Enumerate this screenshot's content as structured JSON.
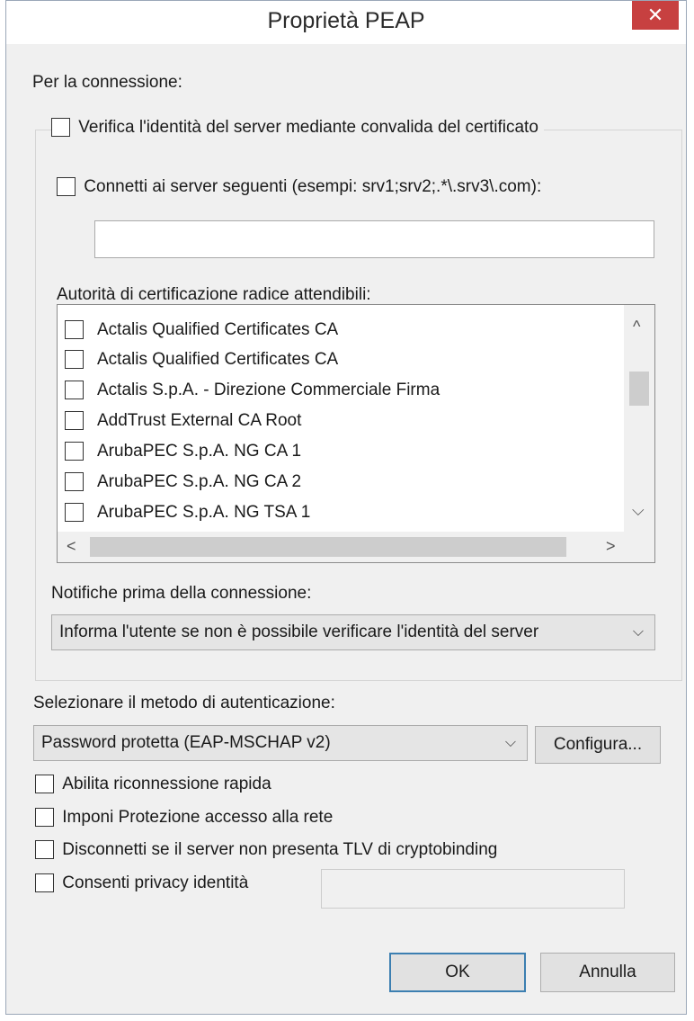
{
  "window": {
    "title": "Proprietà PEAP",
    "close_glyph": "✕"
  },
  "connection": {
    "label": "Per la connessione:",
    "verify_server": {
      "label": "Verifica l'identità del server mediante convalida del certificato",
      "checked": false
    },
    "connect_servers": {
      "label": "Connetti ai server seguenti (esempi: srv1;srv2;.*\\.srv3\\.com):",
      "checked": false,
      "value": ""
    },
    "trusted_ca_label": "Autorità di certificazione radice attendibili:",
    "trusted_ca": [
      {
        "name": "Actalis Qualified Certificates CA",
        "checked": false
      },
      {
        "name": "Actalis Qualified Certificates CA",
        "checked": false
      },
      {
        "name": "Actalis S.p.A. - Direzione Commerciale Firma",
        "checked": false
      },
      {
        "name": "AddTrust External CA Root",
        "checked": false
      },
      {
        "name": "ArubaPEC S.p.A. NG CA 1",
        "checked": false
      },
      {
        "name": "ArubaPEC S.p.A. NG CA 2",
        "checked": false
      },
      {
        "name": "ArubaPEC S.p.A. NG TSA 1",
        "checked": false
      }
    ],
    "notifications_label": "Notifiche prima della connessione:",
    "notifications_value": "Informa l'utente se non è possibile verificare l'identità del server"
  },
  "auth": {
    "label": "Selezionare il metodo di autenticazione:",
    "method_value": "Password protetta (EAP-MSCHAP v2)",
    "configure_label": "Configura..."
  },
  "options": [
    {
      "label": "Abilita riconnessione rapida",
      "checked": false
    },
    {
      "label": "Imponi Protezione accesso alla rete",
      "checked": false
    },
    {
      "label": "Disconnetti se il server non presenta TLV di cryptobinding",
      "checked": false
    },
    {
      "label": "Consenti privacy identità",
      "checked": false
    }
  ],
  "privacy_field_value": "",
  "buttons": {
    "ok_label": "OK",
    "cancel_label": "Annulla"
  },
  "icons": {
    "chevron_down": "⌵",
    "chevron_up": "^",
    "chevron_left": "<",
    "chevron_right": ">"
  }
}
